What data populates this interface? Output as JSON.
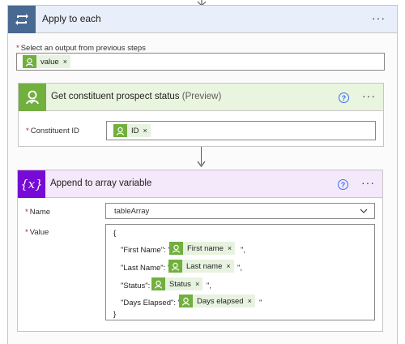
{
  "loop": {
    "title": "Apply to each",
    "select_label": "Select an output from previous steps",
    "token": "value"
  },
  "constituent_action": {
    "title": "Get constituent prospect status",
    "title_suffix": "(Preview)",
    "field_label": "Constituent ID",
    "token": "ID"
  },
  "append_action": {
    "title": "Append to array variable",
    "name_label": "Name",
    "name_value": "tableArray",
    "value_label": "Value",
    "open_brace": "{",
    "close_brace": "}",
    "lines": [
      {
        "key": "\"First Name\": \"",
        "token": "First name",
        "tail": "\","
      },
      {
        "key": "\"Last Name\": \"",
        "token": "Last name",
        "tail": "\","
      },
      {
        "key": "\"Status\": \"",
        "token": "Status",
        "tail": "\","
      },
      {
        "key": "\"Days Elapsed\": \"",
        "token": "Days elapsed",
        "tail": "\""
      }
    ]
  },
  "common": {
    "required_mark": "*",
    "remove_mark": "×",
    "more_dots": "···",
    "help_mark": "?"
  },
  "colors": {
    "loop_header": "#e8eefa",
    "loop_icon": "#486991",
    "constituent_header": "#e9f5df",
    "constituent_icon": "#71af3e",
    "variable_header": "#f3e9fb",
    "variable_icon": "#770bd6",
    "token_bg": "#e7f3e0"
  },
  "icons": {
    "loop": "loop-icon",
    "constituent": "person-check-icon",
    "variable": "variable-braces-icon",
    "help": "question-circle-icon",
    "more": "ellipsis-icon",
    "dropdown": "chevron-down-icon"
  }
}
